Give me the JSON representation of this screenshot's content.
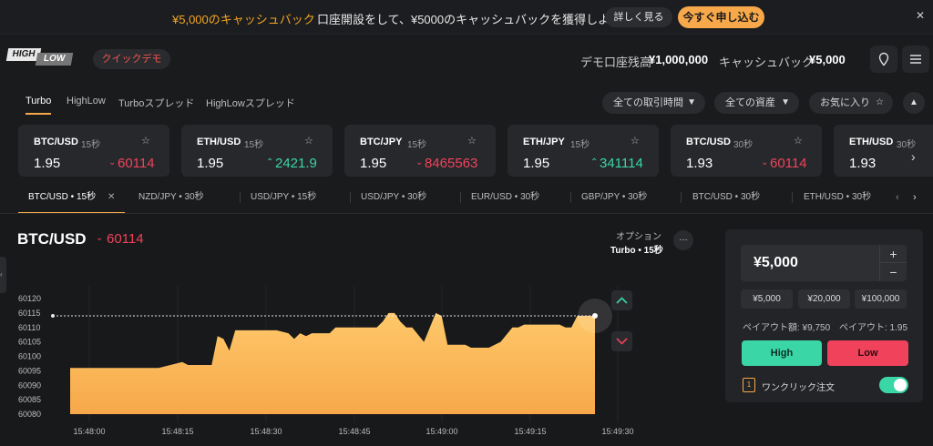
{
  "promo": {
    "amount": "¥5,000のキャッシュバック",
    "text": "口座開設をして、¥5000のキャッシュバックを獲得しよう!",
    "more_label": "詳しく見る",
    "apply_label": "今すぐ申し込む",
    "close": "✕"
  },
  "header": {
    "logo_high": "HIGH",
    "logo_low": "LOW",
    "quick_demo": "クイックデモ",
    "demo_balance_label": "デモ口座残高",
    "demo_balance_value": "¥1,000,000",
    "cashback_label": "キャッシュバック",
    "cashback_value": "¥5,000"
  },
  "tabs": {
    "items": [
      "Turbo",
      "HighLow",
      "Turboスプレッド",
      "HighLowスプレッド"
    ],
    "filters": [
      "全ての取引時間",
      "全ての資産",
      "お気に入り"
    ]
  },
  "cards": [
    {
      "name": "BTC/USD",
      "duration": "15秒",
      "payout": "1.95",
      "price": "60114",
      "direction": "down"
    },
    {
      "name": "ETH/USD",
      "duration": "15秒",
      "payout": "1.95",
      "price": "2421.9",
      "direction": "up"
    },
    {
      "name": "BTC/JPY",
      "duration": "15秒",
      "payout": "1.95",
      "price": "8465563",
      "direction": "down"
    },
    {
      "name": "ETH/JPY",
      "duration": "15秒",
      "payout": "1.95",
      "price": "341114",
      "direction": "up"
    },
    {
      "name": "BTC/USD",
      "duration": "30秒",
      "payout": "1.93",
      "price": "60114",
      "direction": "down"
    },
    {
      "name": "ETH/USD",
      "duration": "30秒",
      "payout": "1.93",
      "price": "",
      "direction": "up"
    }
  ],
  "pairs": [
    "BTC/USD • 15秒",
    "NZD/JPY • 30秒",
    "USD/JPY • 15秒",
    "USD/JPY • 30秒",
    "EUR/USD • 30秒",
    "GBP/JPY • 30秒",
    "BTC/USD • 30秒",
    "ETH/USD • 30秒"
  ],
  "chart": {
    "asset": "BTC/USD",
    "price": "60114",
    "option_label": "オプション",
    "option_value": "Turbo • 15秒"
  },
  "chart_data": {
    "type": "area",
    "x_ticks": [
      "15:48:00",
      "15:48:15",
      "15:48:30",
      "15:48:45",
      "15:49:00",
      "15:49:15",
      "15:49:30"
    ],
    "y_ticks": [
      60080,
      60085,
      60090,
      60095,
      60100,
      60105,
      60110,
      60115,
      60120
    ],
    "ylim": [
      60080,
      60120
    ],
    "current_price": 60114,
    "x": [
      0,
      3,
      6,
      9,
      12,
      15,
      17,
      19,
      20,
      21,
      24,
      25,
      26,
      27,
      28,
      29,
      30,
      31,
      33,
      35,
      37,
      38,
      39,
      40,
      41,
      43,
      44,
      45,
      47,
      49,
      50,
      51,
      52,
      53,
      54,
      55,
      56,
      57,
      58,
      60,
      62,
      63,
      64,
      66,
      67,
      68,
      69,
      71,
      73,
      75,
      76,
      77,
      78,
      79,
      81,
      83,
      84,
      85,
      86,
      87,
      88,
      89
    ],
    "y": [
      60096,
      60096,
      60096,
      60096,
      60096,
      60096,
      60097,
      60098,
      60097,
      60097,
      60097,
      60107,
      60106,
      60102,
      60109,
      60109,
      60109,
      60109,
      60109,
      60109,
      60108,
      60106,
      60108,
      60107,
      60108,
      60108,
      60108,
      60110,
      60110,
      60110,
      60110,
      60110,
      60110,
      60112,
      60115,
      60115,
      60112,
      60110,
      60110,
      60105,
      60115,
      60114,
      60104,
      60104,
      60104,
      60103,
      60103,
      60103,
      60105,
      60110,
      60110,
      60111,
      60111,
      60111,
      60111,
      60111,
      60110,
      60110,
      60114,
      60114,
      60114,
      60114
    ]
  },
  "order": {
    "amount": "¥5,000",
    "plus": "+",
    "minus": "−",
    "presets": [
      "¥5,000",
      "¥20,000",
      "¥100,000"
    ],
    "payout_amount": "ペイアウト額: ¥9,750",
    "payout_rate": "ペイアウト: 1.95",
    "high_label": "High",
    "low_label": "Low",
    "one_click_label": "ワンクリック注文",
    "one_click_on": true
  },
  "colors": {
    "accent": "#f7a84a",
    "up": "#3ad6a6",
    "down": "#f0425a",
    "area": "#fcb85e"
  }
}
